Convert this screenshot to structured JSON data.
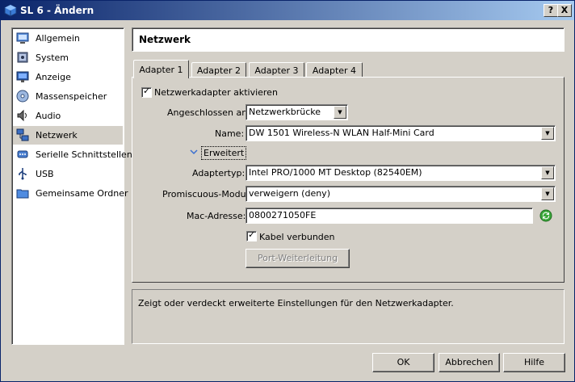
{
  "window": {
    "title": "SL 6 - Ändern",
    "help_btn": "?",
    "close_btn": "X"
  },
  "sidebar": {
    "items": [
      {
        "label": "Allgemein",
        "icon": "general-icon"
      },
      {
        "label": "System",
        "icon": "system-icon"
      },
      {
        "label": "Anzeige",
        "icon": "display-icon"
      },
      {
        "label": "Massenspeicher",
        "icon": "storage-icon"
      },
      {
        "label": "Audio",
        "icon": "audio-icon"
      },
      {
        "label": "Netzwerk",
        "icon": "network-icon",
        "selected": true
      },
      {
        "label": "Serielle Schnittstellen",
        "icon": "serial-port-icon"
      },
      {
        "label": "USB",
        "icon": "usb-icon"
      },
      {
        "label": "Gemeinsame Ordner",
        "icon": "shared-folder-icon"
      }
    ]
  },
  "header": {
    "title": "Netzwerk"
  },
  "tabs": [
    {
      "label": "Adapter 1",
      "active": true
    },
    {
      "label": "Adapter 2"
    },
    {
      "label": "Adapter 3"
    },
    {
      "label": "Adapter 4"
    }
  ],
  "form": {
    "enable_label": "Netzwerkadapter aktivieren",
    "enable_checked": true,
    "attached_label": "Angeschlossen an:",
    "attached_value": "Netzwerkbrücke",
    "name_label": "Name:",
    "name_value": "DW 1501 Wireless-N WLAN Half-Mini Card",
    "advanced_label": "Erweitert",
    "adapter_type_label": "Adaptertyp:",
    "adapter_type_value": "Intel PRO/1000 MT Desktop (82540EM)",
    "promisc_label": "Promiscuous-Modus:",
    "promisc_value": "verweigern (deny)",
    "mac_label": "Mac-Adresse:",
    "mac_value": "0800271050FE",
    "cable_label": "Kabel verbunden",
    "cable_checked": true,
    "port_forward_label": "Port-Weiterleitung"
  },
  "help_text": "Zeigt oder verdeckt erweiterte Einstellungen für den Netzwerkadapter.",
  "buttons": {
    "ok": "OK",
    "cancel": "Abbrechen",
    "help": "Hilfe"
  },
  "colors": {
    "titlebar_start": "#0a246a",
    "titlebar_end": "#a6caf0",
    "face": "#d4d0c8"
  }
}
